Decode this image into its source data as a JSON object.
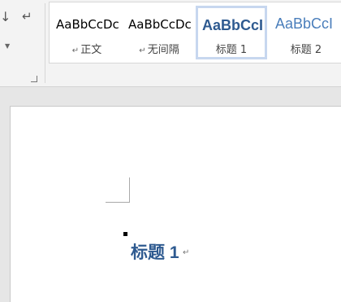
{
  "ribbon": {
    "paragraph": {
      "sort_icon": "↓",
      "para_mark_icon": "↵",
      "dropdown_icon": "▼"
    },
    "styles": [
      {
        "preview": "AaBbCcDc",
        "name": "正文",
        "selected": false
      },
      {
        "preview": "AaBbCcDc",
        "name": "无间隔",
        "selected": false
      },
      {
        "preview": "AaBbCcI",
        "name": "标题 1",
        "selected": true
      },
      {
        "preview": "AaBbCcI",
        "name": "标题 2",
        "selected": false
      }
    ],
    "name_mark": "↵"
  },
  "document": {
    "heading": "标题 1",
    "paragraph_mark": "↵"
  },
  "colors": {
    "heading1": "#2e5a90",
    "heading2": "#4a7ebb",
    "selected_border": "#c7d7ef"
  }
}
